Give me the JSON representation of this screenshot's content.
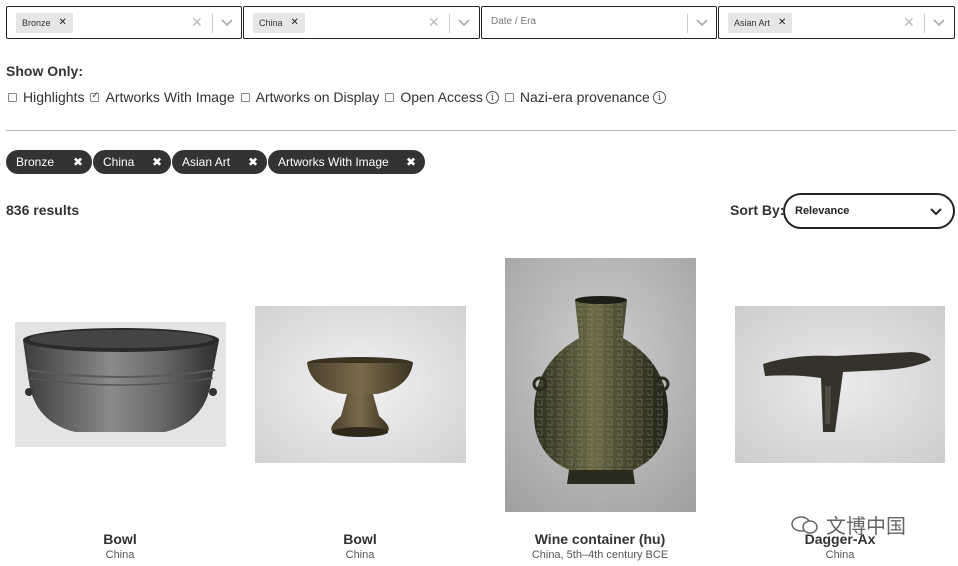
{
  "filters": [
    {
      "selected": "Bronze",
      "placeholder": ""
    },
    {
      "selected": "China",
      "placeholder": ""
    },
    {
      "selected": "",
      "placeholder": "Date / Era"
    },
    {
      "selected": "Asian Art",
      "placeholder": ""
    }
  ],
  "show_only": {
    "heading": "Show Only:",
    "options": [
      {
        "label": "Highlights",
        "checked": false
      },
      {
        "label": "Artworks With Image",
        "checked": true
      },
      {
        "label": "Artworks on Display",
        "checked": false
      },
      {
        "label": "Open Access",
        "checked": false,
        "info": true
      },
      {
        "label": "Nazi-era provenance",
        "checked": false,
        "info": true
      }
    ]
  },
  "active_filters": [
    "Bronze",
    "China",
    "Asian Art",
    "Artworks With Image"
  ],
  "results_count": "836 results",
  "sort": {
    "label": "Sort By:",
    "value": "Relevance"
  },
  "artworks": [
    {
      "title": "Bowl",
      "subtitle": "China"
    },
    {
      "title": "Bowl",
      "subtitle": "China"
    },
    {
      "title": "Wine container (hu)",
      "subtitle": "China, 5th–4th century BCE"
    },
    {
      "title": "Dagger-Ax",
      "subtitle": "China"
    }
  ],
  "watermark": "文博中国",
  "colors": {
    "pill_bg": "#333333",
    "border": "#222222",
    "text": "#333333"
  }
}
